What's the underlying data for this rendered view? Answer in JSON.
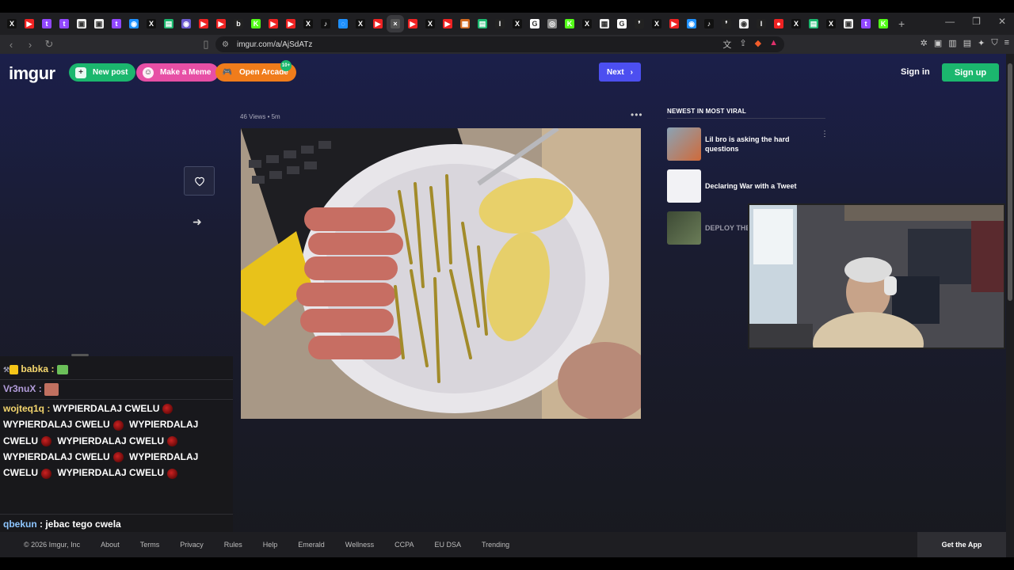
{
  "browser": {
    "tabs": [
      {
        "icon": "x-icon",
        "label": "X",
        "color": "#111"
      },
      {
        "icon": "youtube-icon",
        "label": "▶",
        "color": "#e22"
      },
      {
        "icon": "twitch-icon",
        "label": "t",
        "color": "#9147ff"
      },
      {
        "icon": "twitch-icon",
        "label": "t",
        "color": "#9147ff"
      },
      {
        "icon": "app-icon",
        "label": "▣",
        "color": "#eee"
      },
      {
        "icon": "app-icon",
        "label": "▣",
        "color": "#eee"
      },
      {
        "icon": "twitch-icon",
        "label": "t",
        "color": "#9147ff"
      },
      {
        "icon": "chat-icon",
        "label": "◉",
        "color": "#1e90ff"
      },
      {
        "icon": "x-icon",
        "label": "X",
        "color": "#111"
      },
      {
        "icon": "sheet-icon",
        "label": "▤",
        "color": "#1bb76e"
      },
      {
        "icon": "app-icon",
        "label": "◉",
        "color": "#6a5acd"
      },
      {
        "icon": "youtube-icon",
        "label": "▶",
        "color": "#e22"
      },
      {
        "icon": "youtube-icon",
        "label": "▶",
        "color": "#e22"
      },
      {
        "icon": "b-icon",
        "label": "b",
        "color": "#222"
      },
      {
        "icon": "kick-icon",
        "label": "K",
        "color": "#53fc18"
      },
      {
        "icon": "youtube-icon",
        "label": "▶",
        "color": "#e22"
      },
      {
        "icon": "youtube-icon",
        "label": "▶",
        "color": "#e22"
      },
      {
        "icon": "x-icon",
        "label": "X",
        "color": "#111"
      },
      {
        "icon": "tiktok-icon",
        "label": "♪",
        "color": "#111"
      },
      {
        "icon": "app-icon",
        "label": "◌",
        "color": "#1e90ff"
      },
      {
        "icon": "x-icon",
        "label": "X",
        "color": "#111"
      },
      {
        "icon": "youtube-icon",
        "label": "▶",
        "color": "#e22"
      },
      {
        "icon": "imgur-icon",
        "label": "×",
        "color": "#555",
        "active": true
      },
      {
        "icon": "youtube-icon",
        "label": "▶",
        "color": "#e22"
      },
      {
        "icon": "x-icon",
        "label": "X",
        "color": "#111"
      },
      {
        "icon": "youtube-icon",
        "label": "▶",
        "color": "#e22"
      },
      {
        "icon": "app-icon",
        "label": "▦",
        "color": "#d2691e"
      },
      {
        "icon": "sheet-icon",
        "label": "▤",
        "color": "#1bb76e"
      },
      {
        "icon": "app-icon",
        "label": "I",
        "color": "#222"
      },
      {
        "icon": "x-icon",
        "label": "X",
        "color": "#111"
      },
      {
        "icon": "google-icon",
        "label": "G",
        "color": "#fff"
      },
      {
        "icon": "app-icon",
        "label": "◎",
        "color": "#888"
      },
      {
        "icon": "kick-icon",
        "label": "K",
        "color": "#53fc18"
      },
      {
        "icon": "x-icon",
        "label": "X",
        "color": "#111"
      },
      {
        "icon": "app-icon",
        "label": "▦",
        "color": "#eee"
      },
      {
        "icon": "google-icon",
        "label": "G",
        "color": "#fff"
      },
      {
        "icon": "app-icon",
        "label": "❜",
        "color": "#222"
      },
      {
        "icon": "x-icon",
        "label": "X",
        "color": "#111"
      },
      {
        "icon": "youtube-icon",
        "label": "▶",
        "color": "#e22"
      },
      {
        "icon": "chat-icon",
        "label": "◉",
        "color": "#1e90ff"
      },
      {
        "icon": "tiktok-icon",
        "label": "♪",
        "color": "#111"
      },
      {
        "icon": "app-icon",
        "label": "❜",
        "color": "#222"
      },
      {
        "icon": "app-icon",
        "label": "◉",
        "color": "#eee"
      },
      {
        "icon": "app-icon",
        "label": "I",
        "color": "#222"
      },
      {
        "icon": "app-icon",
        "label": "●",
        "color": "#e22"
      },
      {
        "icon": "x-icon",
        "label": "X",
        "color": "#111"
      },
      {
        "icon": "sheet-icon",
        "label": "▤",
        "color": "#1bb76e"
      },
      {
        "icon": "x-icon",
        "label": "X",
        "color": "#111"
      },
      {
        "icon": "app-icon",
        "label": "▣",
        "color": "#eee"
      },
      {
        "icon": "twitch-icon",
        "label": "t",
        "color": "#9147ff"
      },
      {
        "icon": "kick-icon",
        "label": "K",
        "color": "#53fc18"
      }
    ],
    "new_tab": "+",
    "url": "imgur.com/a/AjSdATz"
  },
  "imgur": {
    "logo": "imgur",
    "new_post": "New post",
    "make_meme": "Make a Meme",
    "open_arcade": "Open Arcade",
    "arcade_badge": "10+",
    "next": "Next",
    "sign_in": "Sign in",
    "sign_up": "Sign up",
    "views": "46 Views",
    "age": "5m",
    "newest_title": "NEWEST IN MOST VIRAL",
    "newest": [
      {
        "title": "Lil bro is asking the hard questions",
        "thumb": "#7a8fa0"
      },
      {
        "title": "Declaring War with a Tweet",
        "thumb": "#e9e9ee"
      },
      {
        "title": "DEPLOY THE",
        "thumb": "#5a6b4a"
      }
    ],
    "footer": {
      "copyright": "© 2026 Imgur, Inc",
      "links": [
        "About",
        "Terms",
        "Privacy",
        "Rules",
        "Help",
        "Emerald",
        "Wellness",
        "CCPA",
        "EU DSA",
        "Trending"
      ],
      "get_app": "Get the App"
    }
  },
  "chat": {
    "messages": [
      {
        "user": "babka",
        "color": "#f5d76e"
      },
      {
        "user": "Vr3nuX",
        "color": "#b39ddb"
      },
      {
        "user": "wojteq1q",
        "color": "#f5d76e",
        "text": "WYPIERDALAJ CWELU"
      },
      {
        "user": "qbekun",
        "color": "#8ec6ff",
        "text": "jebac tego cwela"
      }
    ]
  }
}
